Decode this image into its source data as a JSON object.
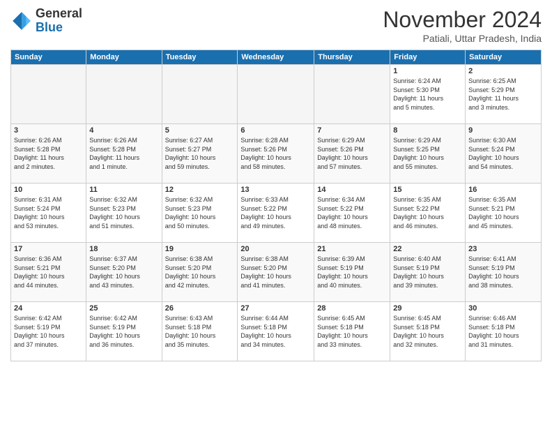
{
  "header": {
    "logo_line1": "General",
    "logo_line2": "Blue",
    "month_title": "November 2024",
    "subtitle": "Patiali, Uttar Pradesh, India"
  },
  "weekdays": [
    "Sunday",
    "Monday",
    "Tuesday",
    "Wednesday",
    "Thursday",
    "Friday",
    "Saturday"
  ],
  "weeks": [
    [
      {
        "day": "",
        "info": ""
      },
      {
        "day": "",
        "info": ""
      },
      {
        "day": "",
        "info": ""
      },
      {
        "day": "",
        "info": ""
      },
      {
        "day": "",
        "info": ""
      },
      {
        "day": "1",
        "info": "Sunrise: 6:24 AM\nSunset: 5:30 PM\nDaylight: 11 hours\nand 5 minutes."
      },
      {
        "day": "2",
        "info": "Sunrise: 6:25 AM\nSunset: 5:29 PM\nDaylight: 11 hours\nand 3 minutes."
      }
    ],
    [
      {
        "day": "3",
        "info": "Sunrise: 6:26 AM\nSunset: 5:28 PM\nDaylight: 11 hours\nand 2 minutes."
      },
      {
        "day": "4",
        "info": "Sunrise: 6:26 AM\nSunset: 5:28 PM\nDaylight: 11 hours\nand 1 minute."
      },
      {
        "day": "5",
        "info": "Sunrise: 6:27 AM\nSunset: 5:27 PM\nDaylight: 10 hours\nand 59 minutes."
      },
      {
        "day": "6",
        "info": "Sunrise: 6:28 AM\nSunset: 5:26 PM\nDaylight: 10 hours\nand 58 minutes."
      },
      {
        "day": "7",
        "info": "Sunrise: 6:29 AM\nSunset: 5:26 PM\nDaylight: 10 hours\nand 57 minutes."
      },
      {
        "day": "8",
        "info": "Sunrise: 6:29 AM\nSunset: 5:25 PM\nDaylight: 10 hours\nand 55 minutes."
      },
      {
        "day": "9",
        "info": "Sunrise: 6:30 AM\nSunset: 5:24 PM\nDaylight: 10 hours\nand 54 minutes."
      }
    ],
    [
      {
        "day": "10",
        "info": "Sunrise: 6:31 AM\nSunset: 5:24 PM\nDaylight: 10 hours\nand 53 minutes."
      },
      {
        "day": "11",
        "info": "Sunrise: 6:32 AM\nSunset: 5:23 PM\nDaylight: 10 hours\nand 51 minutes."
      },
      {
        "day": "12",
        "info": "Sunrise: 6:32 AM\nSunset: 5:23 PM\nDaylight: 10 hours\nand 50 minutes."
      },
      {
        "day": "13",
        "info": "Sunrise: 6:33 AM\nSunset: 5:22 PM\nDaylight: 10 hours\nand 49 minutes."
      },
      {
        "day": "14",
        "info": "Sunrise: 6:34 AM\nSunset: 5:22 PM\nDaylight: 10 hours\nand 48 minutes."
      },
      {
        "day": "15",
        "info": "Sunrise: 6:35 AM\nSunset: 5:22 PM\nDaylight: 10 hours\nand 46 minutes."
      },
      {
        "day": "16",
        "info": "Sunrise: 6:35 AM\nSunset: 5:21 PM\nDaylight: 10 hours\nand 45 minutes."
      }
    ],
    [
      {
        "day": "17",
        "info": "Sunrise: 6:36 AM\nSunset: 5:21 PM\nDaylight: 10 hours\nand 44 minutes."
      },
      {
        "day": "18",
        "info": "Sunrise: 6:37 AM\nSunset: 5:20 PM\nDaylight: 10 hours\nand 43 minutes."
      },
      {
        "day": "19",
        "info": "Sunrise: 6:38 AM\nSunset: 5:20 PM\nDaylight: 10 hours\nand 42 minutes."
      },
      {
        "day": "20",
        "info": "Sunrise: 6:38 AM\nSunset: 5:20 PM\nDaylight: 10 hours\nand 41 minutes."
      },
      {
        "day": "21",
        "info": "Sunrise: 6:39 AM\nSunset: 5:19 PM\nDaylight: 10 hours\nand 40 minutes."
      },
      {
        "day": "22",
        "info": "Sunrise: 6:40 AM\nSunset: 5:19 PM\nDaylight: 10 hours\nand 39 minutes."
      },
      {
        "day": "23",
        "info": "Sunrise: 6:41 AM\nSunset: 5:19 PM\nDaylight: 10 hours\nand 38 minutes."
      }
    ],
    [
      {
        "day": "24",
        "info": "Sunrise: 6:42 AM\nSunset: 5:19 PM\nDaylight: 10 hours\nand 37 minutes."
      },
      {
        "day": "25",
        "info": "Sunrise: 6:42 AM\nSunset: 5:19 PM\nDaylight: 10 hours\nand 36 minutes."
      },
      {
        "day": "26",
        "info": "Sunrise: 6:43 AM\nSunset: 5:18 PM\nDaylight: 10 hours\nand 35 minutes."
      },
      {
        "day": "27",
        "info": "Sunrise: 6:44 AM\nSunset: 5:18 PM\nDaylight: 10 hours\nand 34 minutes."
      },
      {
        "day": "28",
        "info": "Sunrise: 6:45 AM\nSunset: 5:18 PM\nDaylight: 10 hours\nand 33 minutes."
      },
      {
        "day": "29",
        "info": "Sunrise: 6:45 AM\nSunset: 5:18 PM\nDaylight: 10 hours\nand 32 minutes."
      },
      {
        "day": "30",
        "info": "Sunrise: 6:46 AM\nSunset: 5:18 PM\nDaylight: 10 hours\nand 31 minutes."
      }
    ]
  ]
}
